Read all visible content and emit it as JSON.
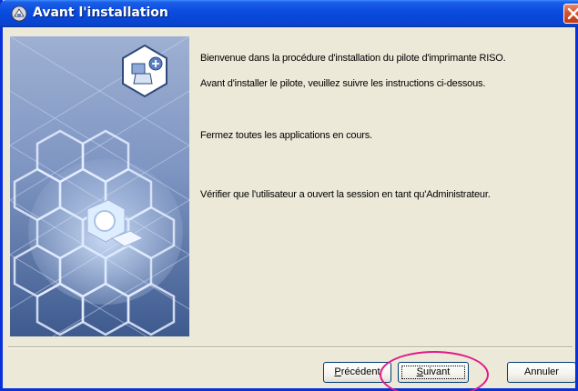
{
  "window": {
    "title": "Avant l'installation",
    "title_icon": "installer-icon",
    "close_icon": "close-icon"
  },
  "banner": {
    "icon": "printer-plus-icon",
    "image": "hexagon-pattern-with-cube"
  },
  "messages": {
    "welcome": "Bienvenue dans la procédure d'installation du pilote d'imprimante RISO.",
    "before": "Avant d'installer le pilote, veuillez suivre les instructions ci-dessous.",
    "close_apps": "Fermez toutes les applications en cours.",
    "admin": "Vérifier que l'utilisateur a ouvert la session en tant qu'Administrateur."
  },
  "buttons": {
    "previous": {
      "mnemonic": "P",
      "rest": "récédent"
    },
    "next": {
      "mnemonic": "S",
      "rest": "uivant"
    },
    "cancel": "Annuler"
  },
  "colors": {
    "titlebar": "#0a4de0",
    "highlight_ring": "#e0198a",
    "dialog_bg": "#ece9d8"
  }
}
